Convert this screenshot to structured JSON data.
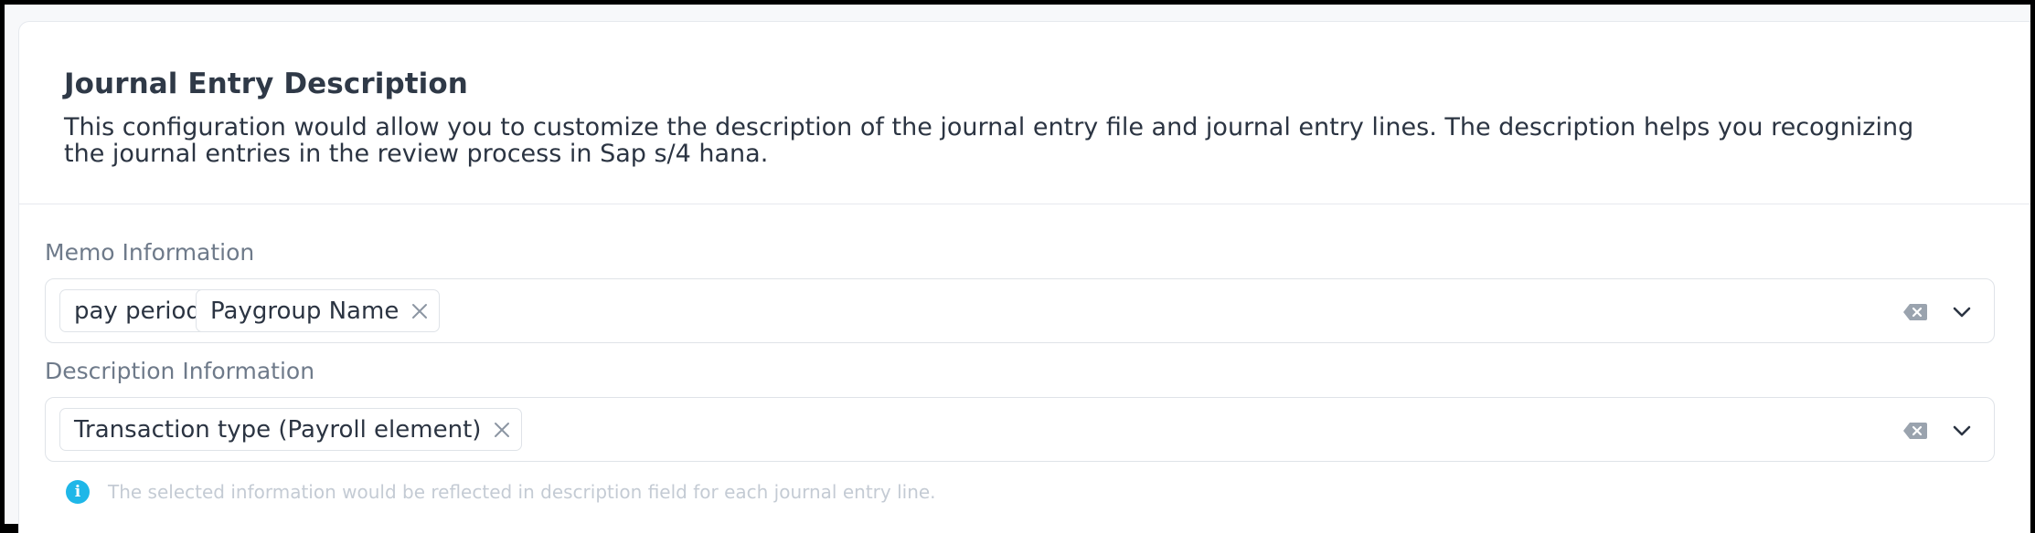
{
  "section": {
    "title": "Journal Entry Description",
    "description": "This configuration would allow you to customize the description of the journal entry file and journal entry lines. The description helps you recognizing the journal entries in the review process in Sap s/4 hana."
  },
  "memo": {
    "label": "Memo Information",
    "chips": [
      "pay period",
      "Paygroup Name"
    ]
  },
  "description_info": {
    "label": "Description Information",
    "chips": [
      "Transaction type (Payroll element)"
    ]
  },
  "hint": {
    "icon": "info-icon",
    "text": "The selected information would be reflected in description field for each journal entry line."
  },
  "icons": {
    "chip_remove": "close-icon",
    "clear": "clear-all-icon",
    "dropdown": "chevron-down-icon"
  },
  "colors": {
    "info_accent": "#1fb7e8",
    "title_text": "#2f3947",
    "label_text": "#6e7a8a"
  }
}
